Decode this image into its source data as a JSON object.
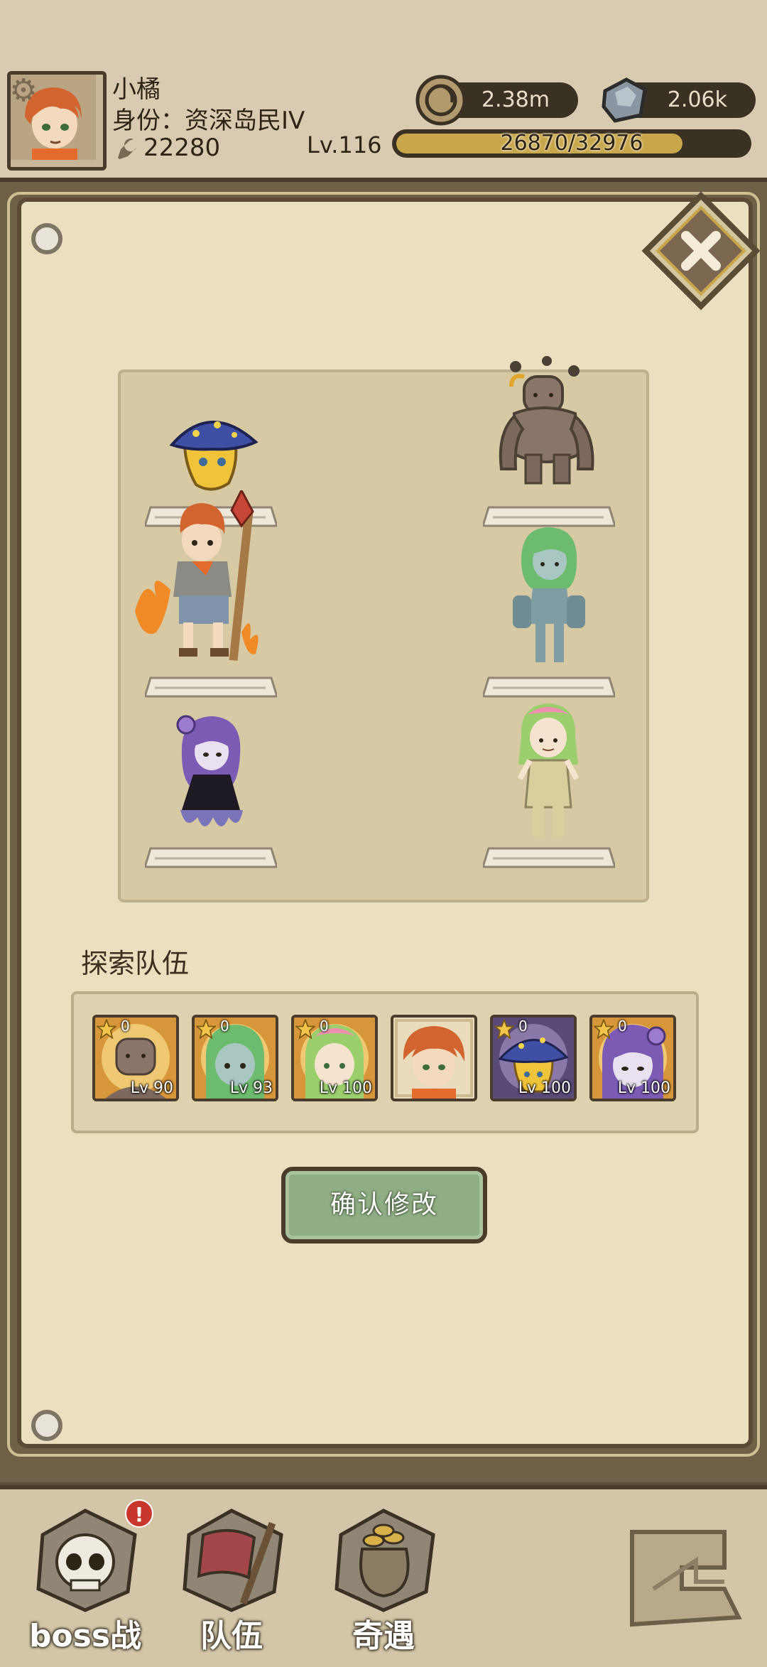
{
  "player": {
    "name": "小橘",
    "rank": "身份：资深岛民IV",
    "power": "22280",
    "level": "Lv.116"
  },
  "resources": {
    "coins": "2.38m",
    "gems": "2.06k"
  },
  "experience": {
    "text": "26870/32976",
    "progress": 0.815
  },
  "team_section": {
    "title": "探索队伍",
    "members": [
      {
        "portrait": "rock-golem",
        "stars": "0",
        "level": "Lv 90"
      },
      {
        "portrait": "green-spirit",
        "stars": "0",
        "level": "Lv 93"
      },
      {
        "portrait": "pink-green-girl",
        "stars": "0",
        "level": "Lv 100"
      },
      {
        "portrait": "orange-hair-boy",
        "stars": "",
        "level": ""
      },
      {
        "portrait": "mushroom-slime",
        "stars": "0",
        "level": "Lv 100"
      },
      {
        "portrait": "purple-octopus-girl",
        "stars": "0",
        "level": "Lv 100"
      }
    ]
  },
  "confirm_label": "确认修改",
  "bottom_nav": {
    "boss": "boss战",
    "team": "队伍",
    "adventure": "奇遇",
    "boss_badge": "!"
  },
  "colors": {
    "panel": "#eadfbf",
    "board": "#d6c9a4",
    "confirm": "#8fae84",
    "dark": "#4a3c2c",
    "badge": "#c8372c"
  }
}
